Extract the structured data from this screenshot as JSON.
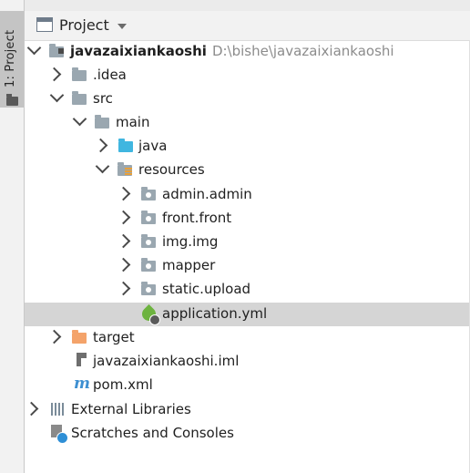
{
  "sidebar": {
    "tab_label": "1: Project"
  },
  "panel": {
    "title": "Project"
  },
  "tree": {
    "root": {
      "name": "javazaixiankaoshi",
      "path": "D:\\bishe\\javazaixiankaoshi"
    },
    "idea": ".idea",
    "src": "src",
    "main": "main",
    "java": "java",
    "resources": "resources",
    "pkgs": [
      "admin.admin",
      "front.front",
      "img.img",
      "mapper",
      "static.upload"
    ],
    "app_yml": "application.yml",
    "target": "target",
    "iml": "javazaixiankaoshi.iml",
    "pom": "pom.xml",
    "pom_glyph": "m",
    "ext_libs": "External Libraries",
    "scratches": "Scratches and Consoles"
  },
  "colors": {
    "selected_row": "#d5d5d5",
    "folder_blue": "#40b6e0",
    "folder_orange": "#f4a36a",
    "spring_green": "#6db33f"
  }
}
